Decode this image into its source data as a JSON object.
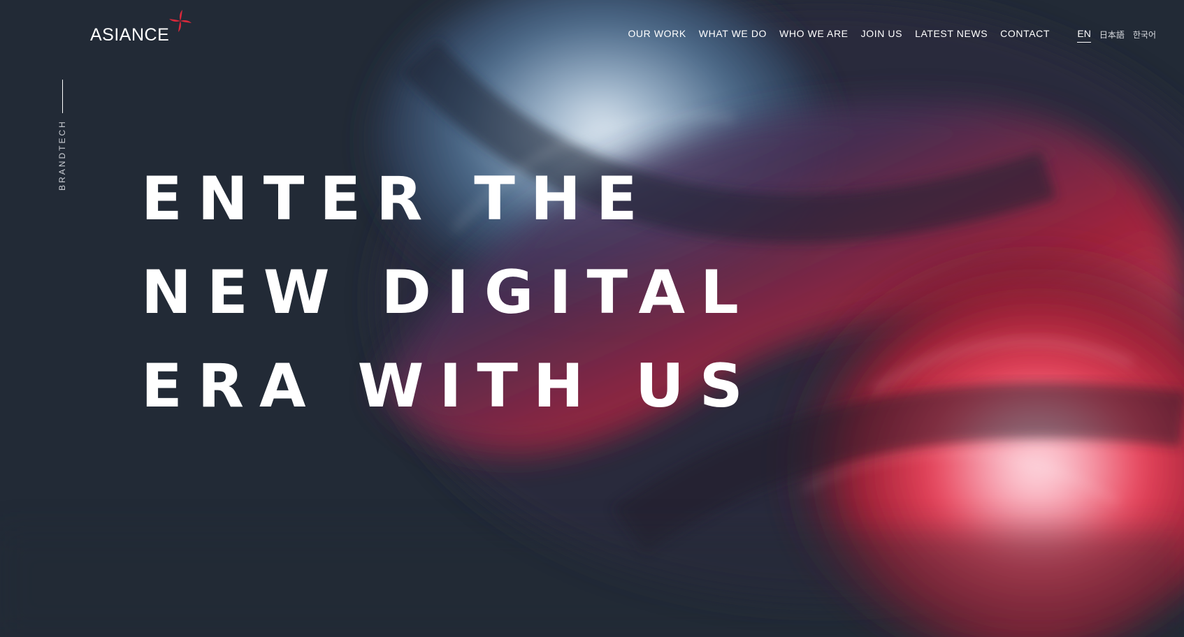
{
  "brand": {
    "name": "ASIANCE",
    "mark_color": "#d9293b"
  },
  "nav": {
    "items": [
      {
        "label": "OUR WORK"
      },
      {
        "label": "WHAT WE DO"
      },
      {
        "label": "WHO WE ARE"
      },
      {
        "label": "JOIN US"
      },
      {
        "label": "LATEST NEWS"
      },
      {
        "label": "CONTACT"
      }
    ]
  },
  "languages": {
    "items": [
      {
        "label": "EN",
        "active": true
      },
      {
        "label": "日本語",
        "active": false
      },
      {
        "label": "한국어",
        "active": false
      }
    ]
  },
  "sidebar": {
    "label": "BRANDTECH"
  },
  "hero": {
    "lines": [
      "ENTER THE",
      "NEW DIGITAL",
      "ERA WITH US"
    ],
    "background_color": "#222a36",
    "accent_colors": [
      "#d9293b",
      "#4f6f8f",
      "#3a2a48"
    ]
  }
}
